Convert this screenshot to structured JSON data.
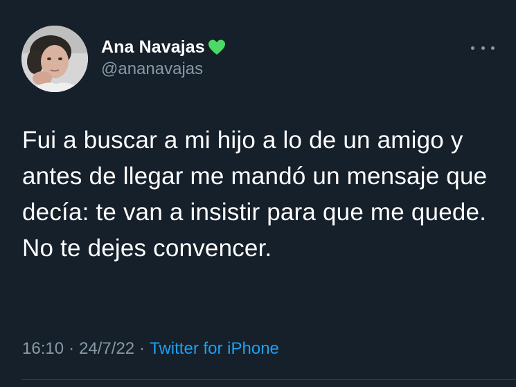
{
  "author": {
    "display_name": "Ana Navajas",
    "emoji": "green-heart",
    "handle": "@ananavajas"
  },
  "tweet": {
    "text": "Fui a buscar a mi hijo a lo de un amigo y antes de llegar me mandó un mensaje que decía: te van a insistir para que me quede. No te dejes convencer."
  },
  "meta": {
    "time": "16:10",
    "separator": "·",
    "date": "24/7/22",
    "source": "Twitter for iPhone"
  },
  "colors": {
    "background": "#15202b",
    "text": "#ffffff",
    "secondary_text": "#8899a6",
    "link": "#1da1f2",
    "heart": "#4cd964"
  }
}
